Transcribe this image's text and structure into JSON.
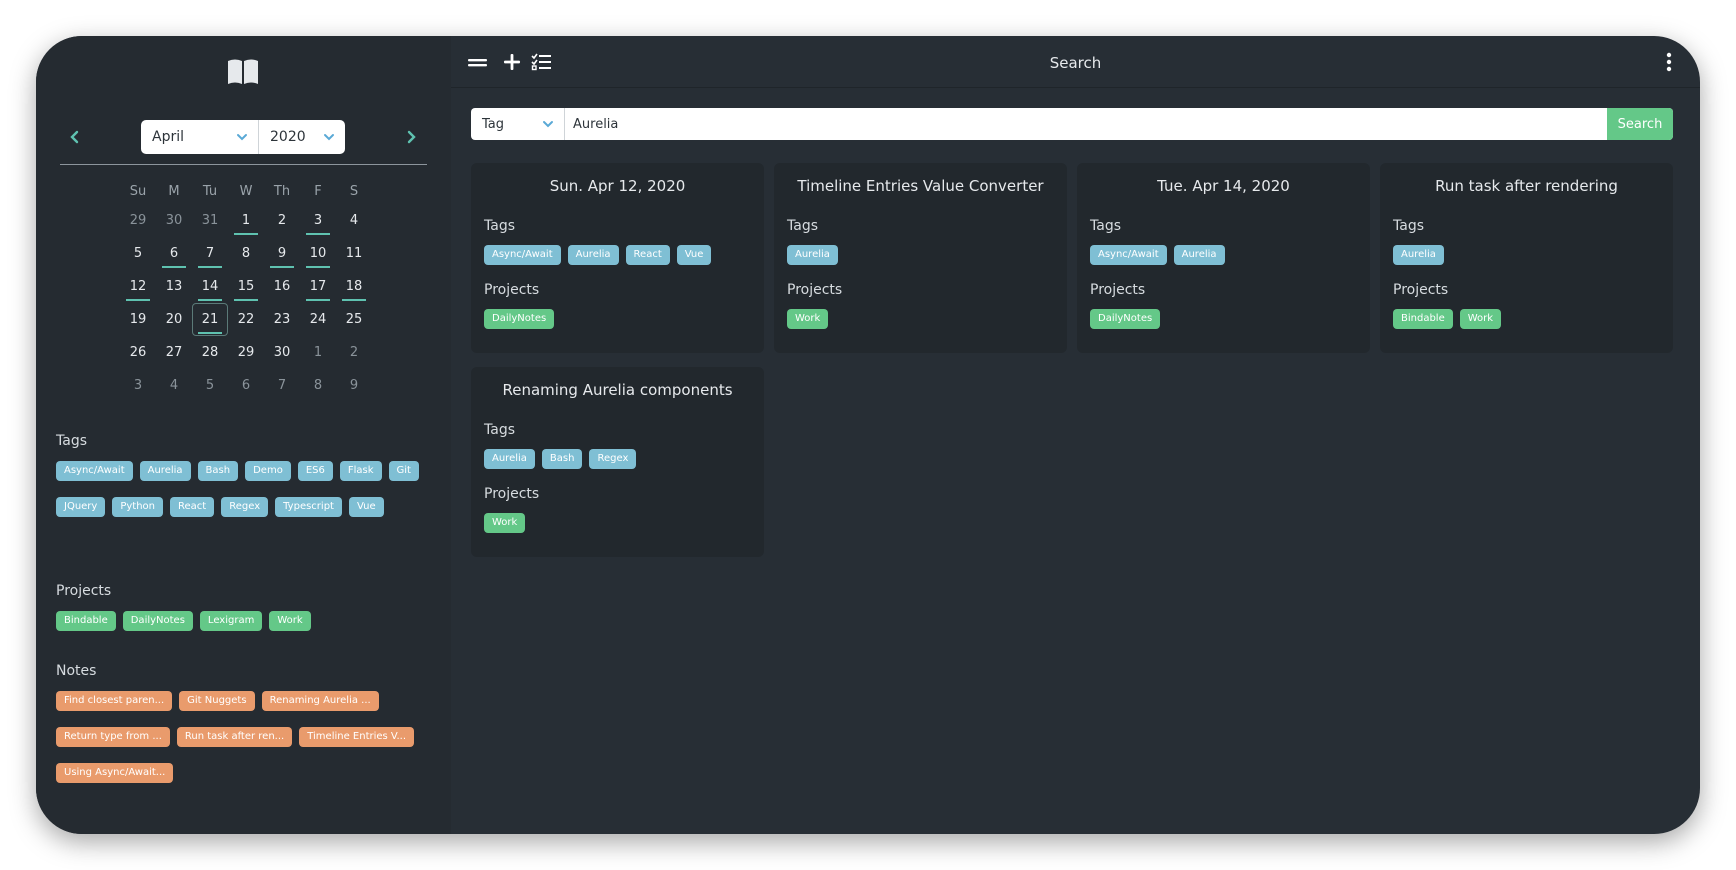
{
  "calendar": {
    "month": "April",
    "year": "2020",
    "weekdays": [
      "Su",
      "M",
      "Tu",
      "W",
      "Th",
      "F",
      "S"
    ],
    "weeks": [
      [
        {
          "d": "29",
          "other": true
        },
        {
          "d": "30",
          "other": true
        },
        {
          "d": "31",
          "other": true
        },
        {
          "d": "1",
          "entry": true
        },
        {
          "d": "2"
        },
        {
          "d": "3",
          "entry": true
        },
        {
          "d": "4"
        }
      ],
      [
        {
          "d": "5"
        },
        {
          "d": "6",
          "entry": true
        },
        {
          "d": "7",
          "entry": true
        },
        {
          "d": "8"
        },
        {
          "d": "9",
          "entry": true
        },
        {
          "d": "10",
          "entry": true
        },
        {
          "d": "11"
        }
      ],
      [
        {
          "d": "12",
          "entry": true
        },
        {
          "d": "13"
        },
        {
          "d": "14",
          "entry": true
        },
        {
          "d": "15",
          "entry": true
        },
        {
          "d": "16"
        },
        {
          "d": "17",
          "entry": true
        },
        {
          "d": "18",
          "entry": true
        }
      ],
      [
        {
          "d": "19"
        },
        {
          "d": "20"
        },
        {
          "d": "21",
          "entry": true,
          "today": true
        },
        {
          "d": "22"
        },
        {
          "d": "23"
        },
        {
          "d": "24"
        },
        {
          "d": "25"
        }
      ],
      [
        {
          "d": "26"
        },
        {
          "d": "27"
        },
        {
          "d": "28"
        },
        {
          "d": "29"
        },
        {
          "d": "30"
        },
        {
          "d": "1",
          "other": true
        },
        {
          "d": "2",
          "other": true
        }
      ],
      [
        {
          "d": "3",
          "other": true
        },
        {
          "d": "4",
          "other": true
        },
        {
          "d": "5",
          "other": true
        },
        {
          "d": "6",
          "other": true
        },
        {
          "d": "7",
          "other": true
        },
        {
          "d": "8",
          "other": true
        },
        {
          "d": "9",
          "other": true
        }
      ]
    ]
  },
  "sidebar": {
    "tags_title": "Tags",
    "tags": [
      "Async/Await",
      "Aurelia",
      "Bash",
      "Demo",
      "ES6",
      "Flask",
      "Git",
      "JQuery",
      "Python",
      "React",
      "Regex",
      "Typescript",
      "Vue"
    ],
    "projects_title": "Projects",
    "projects": [
      "Bindable",
      "DailyNotes",
      "Lexigram",
      "Work"
    ],
    "notes_title": "Notes",
    "notes": [
      "Find closest paren...",
      "Git Nuggets",
      "Renaming Aurelia ...",
      "Return type from ...",
      "Run task after ren...",
      "Timeline Entries V...",
      "Using Async/Await..."
    ]
  },
  "topbar": {
    "title": "Search"
  },
  "search": {
    "type": "Tag",
    "query": "Aurelia",
    "button": "Search"
  },
  "results": {
    "tags_label": "Tags",
    "projects_label": "Projects",
    "cards": [
      {
        "title": "Sun. Apr 12, 2020",
        "tags": [
          "Async/Await",
          "Aurelia",
          "React",
          "Vue"
        ],
        "projects": [
          "DailyNotes"
        ]
      },
      {
        "title": "Timeline Entries Value Converter",
        "tags": [
          "Aurelia"
        ],
        "projects": [
          "Work"
        ]
      },
      {
        "title": "Tue. Apr 14, 2020",
        "tags": [
          "Async/Await",
          "Aurelia"
        ],
        "projects": [
          "DailyNotes"
        ]
      },
      {
        "title": "Run task after rendering",
        "tags": [
          "Aurelia"
        ],
        "projects": [
          "Bindable",
          "Work"
        ]
      },
      {
        "title": "Renaming Aurelia components",
        "tags": [
          "Aurelia",
          "Bash",
          "Regex"
        ],
        "projects": [
          "Work"
        ]
      }
    ]
  },
  "colors": {
    "tag": "#7fbfd4",
    "project": "#64c888",
    "note": "#e99b6c",
    "accent": "#5fc2b0"
  },
  "icons": {
    "logo": "open-book-icon",
    "prev": "chevron-left-icon",
    "next": "chevron-right-icon",
    "menu": "hamburger-icon",
    "add": "plus-icon",
    "checklist": "checklist-icon",
    "more": "kebab-icon"
  }
}
